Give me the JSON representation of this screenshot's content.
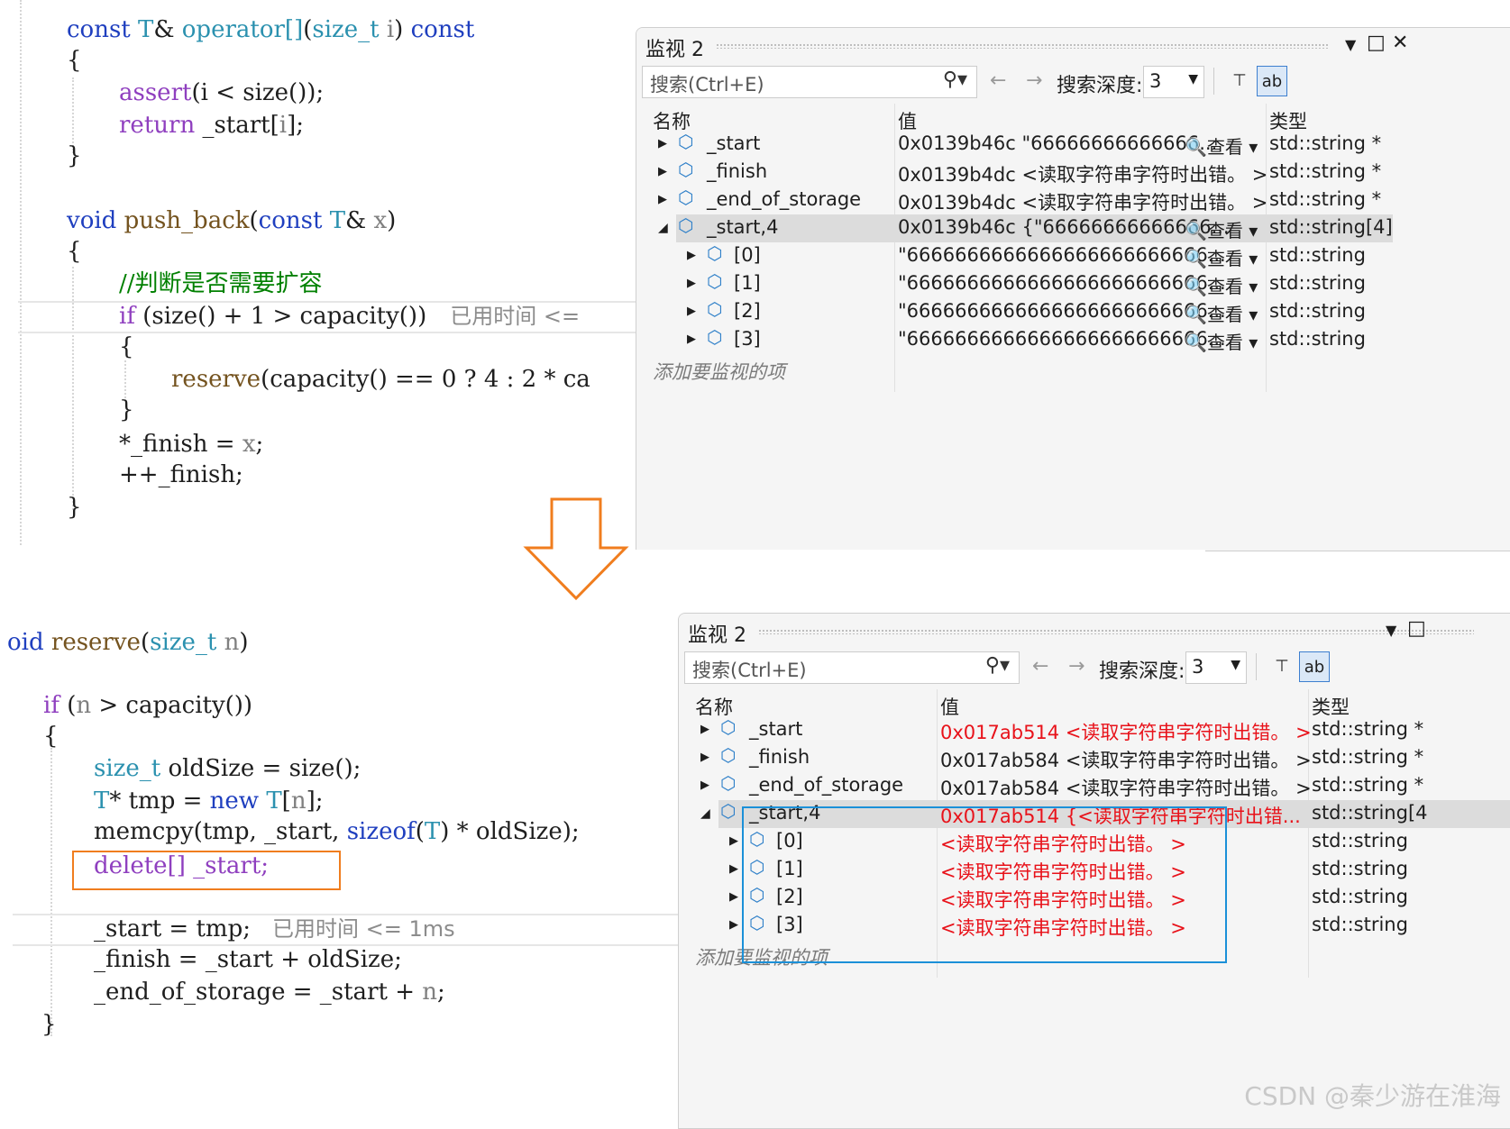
{
  "top_code": {
    "l1": {
      "a": "const ",
      "b": "T",
      "c": "& ",
      "d": "operator[]",
      "e": "(",
      "f": "size_t",
      "g": " i",
      "h": ") ",
      "i": "const"
    },
    "l2": "{",
    "l3": {
      "a": "assert",
      "b": "(i ",
      "c": "<",
      "d": " size());"
    },
    "l4": {
      "a": "return",
      "b": " _start[",
      "c": "i",
      "d": "];"
    },
    "l5": "}",
    "l6": {
      "a": "void ",
      "b": "push_back",
      "c": "(",
      "d": "const ",
      "e": "T",
      "f": "& ",
      "g": "x",
      "h": ")"
    },
    "l7": "{",
    "l8": "//判断是否需要扩容",
    "l9": {
      "a": "if ",
      "b": "(size() + 1 ",
      "c": ">",
      "d": " capacity())",
      "hint": "已用时间 <="
    },
    "l10": "{",
    "l11": {
      "a": "reserve",
      "b": "(capacity() == 0 ? 4 : 2 * ca"
    },
    "l12": "}",
    "l13": {
      "a": "*_finish = ",
      "b": "x",
      "c": ";"
    },
    "l14": "++_finish;",
    "l15": "}"
  },
  "bottom_code": {
    "l1": {
      "a": "oid ",
      "b": "reserve",
      "c": "(",
      "d": "size_t",
      "e": " n",
      "f": ")"
    },
    "l2": {
      "a": "if ",
      "b": "(",
      "c": "n",
      "d": " > capacity())"
    },
    "l3": "{",
    "l4": {
      "a": "size_t",
      "b": " oldSize = size();"
    },
    "l5": {
      "a": "T",
      "b": "* tmp = ",
      "c": "new ",
      "d": "T",
      "e": "[",
      "f": "n",
      "g": "];"
    },
    "l6": {
      "a": "memcpy",
      "b": "(tmp, _start, ",
      "c": "sizeof",
      "d": "(",
      "e": "T",
      "f": ") * oldSize);"
    },
    "l7": "delete[] _start;",
    "l8": {
      "a": "_start = tmp;",
      "hint": "已用时间 <= 1ms"
    },
    "l9": {
      "a": "_finish = _start + oldSize;"
    },
    "l10": {
      "a": "_end_of_storage = _start + ",
      "b": "n",
      "c": ";"
    },
    "l11": "}"
  },
  "watch_top": {
    "title": "监视 2",
    "search_placeholder": "搜索(Ctrl+E)",
    "depth_label": "搜索深度:",
    "depth_value": "3",
    "col_name": "名称",
    "col_value": "值",
    "col_type": "类型",
    "rows": [
      {
        "name": "_start",
        "value": "0x0139b46c \"66666666666666...",
        "look": "查看",
        "type": "std::string *"
      },
      {
        "name": "_finish",
        "value": "0x0139b4dc <读取字符串字符时出错。 >",
        "type": "std::string *"
      },
      {
        "name": "_end_of_storage",
        "value": "0x0139b4dc <读取字符串字符时出错。 >",
        "type": "std::string *"
      },
      {
        "name": "_start,4",
        "value": "0x0139b46c {\"66666666666666...",
        "look": "查看",
        "type": "std::string[4]"
      },
      {
        "name": "[0]",
        "value": "\"6666666666666666666666666...",
        "look": "查看",
        "type": "std::string"
      },
      {
        "name": "[1]",
        "value": "\"6666666666666666666666666...",
        "look": "查看",
        "type": "std::string"
      },
      {
        "name": "[2]",
        "value": "\"6666666666666666666666666...",
        "look": "查看",
        "type": "std::string"
      },
      {
        "name": "[3]",
        "value": "\"6666666666666666666666666...",
        "look": "查看",
        "type": "std::string"
      }
    ],
    "add_item": "添加要监视的项"
  },
  "watch_bottom": {
    "title": "监视 2",
    "search_placeholder": "搜索(Ctrl+E)",
    "depth_label": "搜索深度:",
    "depth_value": "3",
    "col_name": "名称",
    "col_value": "值",
    "col_type": "类型",
    "rows": [
      {
        "name": "_start",
        "addr": "0x017ab514",
        "value": " <读取字符串字符时出错。 >",
        "type": "std::string *"
      },
      {
        "name": "_finish",
        "addr": "0x017ab584",
        "value": " <读取字符串字符时出错。 >",
        "type": "std::string *"
      },
      {
        "name": "_end_of_storage",
        "addr": "0x017ab584",
        "value": " <读取字符串字符时出错。 >",
        "type": "std::string *"
      },
      {
        "name": "_start,4",
        "addr": "0x017ab514",
        "value": " {<读取字符串字符时出错...",
        "type": "std::string[4"
      },
      {
        "name": "[0]",
        "value": "<读取字符串字符时出错。 >",
        "type": "std::string"
      },
      {
        "name": "[1]",
        "value": "<读取字符串字符时出错。 >",
        "type": "std::string"
      },
      {
        "name": "[2]",
        "value": "<读取字符串字符时出错。 >",
        "type": "std::string"
      },
      {
        "name": "[3]",
        "value": "<读取字符串字符时出错。 >",
        "type": "std::string"
      }
    ],
    "add_item": "添加要监视的项"
  },
  "watermark": "CSDN @秦少游在淮海",
  "colors": {
    "accent_orange": "#f07d1e",
    "accent_blue": "#1b90d8",
    "error_red": "#e8121a"
  }
}
